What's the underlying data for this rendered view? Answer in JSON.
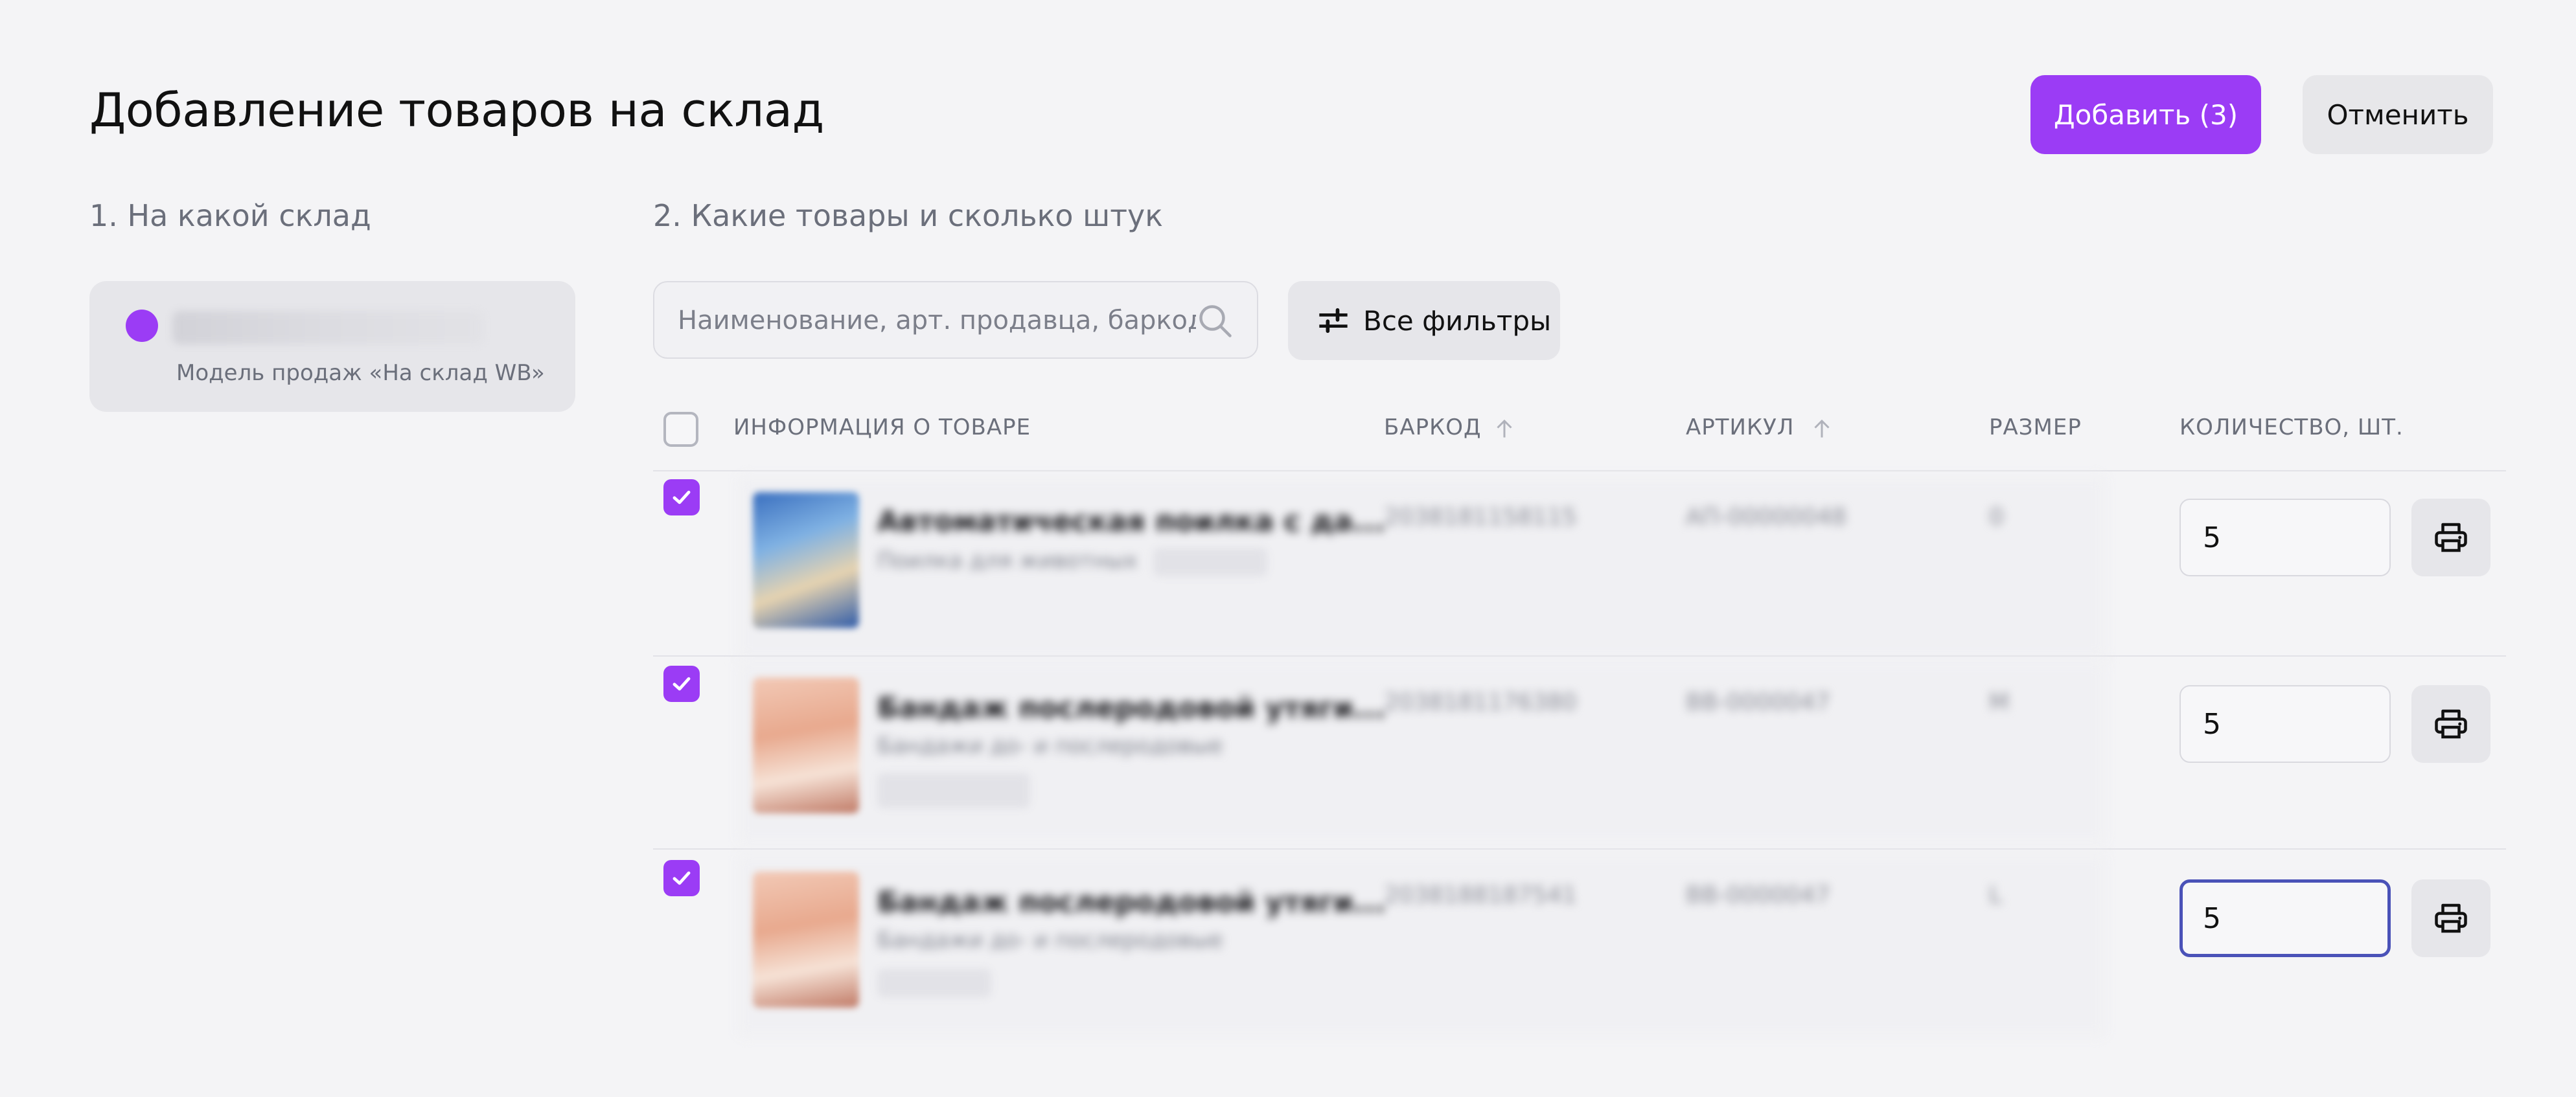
{
  "header": {
    "title": "Добавление товаров на склад",
    "add_button": "Добавить (3)",
    "cancel_button": "Отменить"
  },
  "colors": {
    "accent": "#9b3cf5",
    "focus": "#4a52b8",
    "background": "#f4f4f6"
  },
  "step1": {
    "title": "1. На какой склад",
    "warehouse": {
      "selected": true,
      "sales_model": "Модель продаж «На склад WB»"
    }
  },
  "step2": {
    "title": "2. Какие товары и сколько штук",
    "search": {
      "placeholder": "Наименование, арт. продавца, баркод",
      "value": ""
    },
    "filters_button": "Все фильтры"
  },
  "table": {
    "columns": {
      "info": "ИНФОРМАЦИЯ О ТОВАРЕ",
      "barcode": "БАРКОД",
      "article": "АРТИКУЛ",
      "size": "РАЗМЕР",
      "quantity": "КОЛИЧЕСТВО, ШТ."
    },
    "rows": [
      {
        "checked": true,
        "name": "Автоматическая поилка с да...",
        "subtitle": "Поилка для животных",
        "barcode": "2038181158115",
        "article": "АП-00000048",
        "size": "0",
        "quantity": "5"
      },
      {
        "checked": true,
        "name": "Бандаж послеродовой утяги...",
        "subtitle": "Бандажи до- и послеродовые",
        "barcode": "2038181176380",
        "article": "BB-0000047",
        "size": "M",
        "quantity": "5"
      },
      {
        "checked": true,
        "name": "Бандаж послеродовой утяги...",
        "subtitle": "Бандажи до- и послеродовые",
        "barcode": "2038188187541",
        "article": "BB-0000047",
        "size": "L",
        "quantity": "5"
      }
    ]
  }
}
